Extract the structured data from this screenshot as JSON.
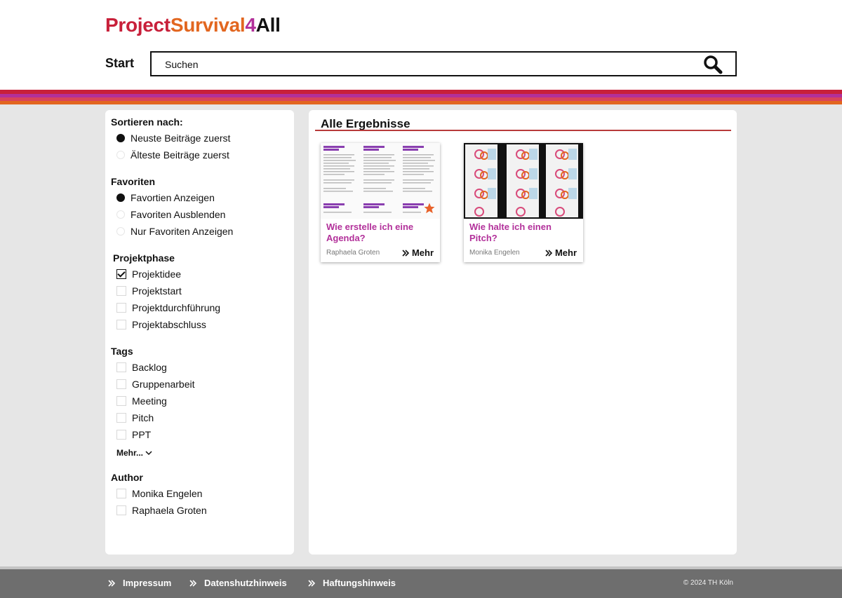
{
  "header": {
    "logo": {
      "part1": "Project",
      "part2": "Survival",
      "part3": "4",
      "part4": "All"
    },
    "start_label": "Start",
    "search": {
      "placeholder": "Suchen",
      "icon": "search-icon"
    }
  },
  "colors": {
    "brand_red": "#c8203a",
    "brand_orange": "#e2661f",
    "brand_magenta": "#b2309a",
    "footer_bg": "#6e6e6e"
  },
  "sidebar": {
    "sort": {
      "title": "Sortieren nach:",
      "options": [
        {
          "label": "Neuste Beiträge zuerst",
          "selected": true
        },
        {
          "label": "Älteste Beiträge zuerst",
          "selected": false
        }
      ]
    },
    "favorites": {
      "title": "Favoriten",
      "options": [
        {
          "label": "Favortien Anzeigen",
          "selected": true
        },
        {
          "label": "Favoriten Ausblenden",
          "selected": false
        },
        {
          "label": "Nur Favoriten Anzeigen",
          "selected": false
        }
      ]
    },
    "phase": {
      "title": "Projektphase",
      "options": [
        {
          "label": "Projektidee",
          "checked": true
        },
        {
          "label": "Projektstart",
          "checked": false
        },
        {
          "label": "Projektdurchführung",
          "checked": false
        },
        {
          "label": "Projektabschluss",
          "checked": false
        }
      ]
    },
    "tags": {
      "title": "Tags",
      "options": [
        {
          "label": "Backlog",
          "checked": false
        },
        {
          "label": "Gruppenarbeit",
          "checked": false
        },
        {
          "label": "Meeting",
          "checked": false
        },
        {
          "label": "Pitch",
          "checked": false
        },
        {
          "label": "PPT",
          "checked": false
        }
      ],
      "more_label": "Mehr..."
    },
    "author": {
      "title": "Author",
      "options": [
        {
          "label": "Monika Engelen",
          "checked": false
        },
        {
          "label": "Raphaela Groten",
          "checked": false
        }
      ]
    }
  },
  "main": {
    "title": "Alle Ergebnisse",
    "cards": [
      {
        "title": "Wie erstelle ich eine Agenda?",
        "author": "Raphaela Groten",
        "more": "Mehr",
        "favorite": true
      },
      {
        "title": "Wie halte ich einen Pitch?",
        "author": "Monika Engelen",
        "more": "Mehr",
        "favorite": false
      }
    ]
  },
  "footer": {
    "links": [
      "Impressum",
      "Datenshutzhinweis",
      "Haftungshinweis"
    ],
    "copyright": "© 2024 TH Köln"
  }
}
